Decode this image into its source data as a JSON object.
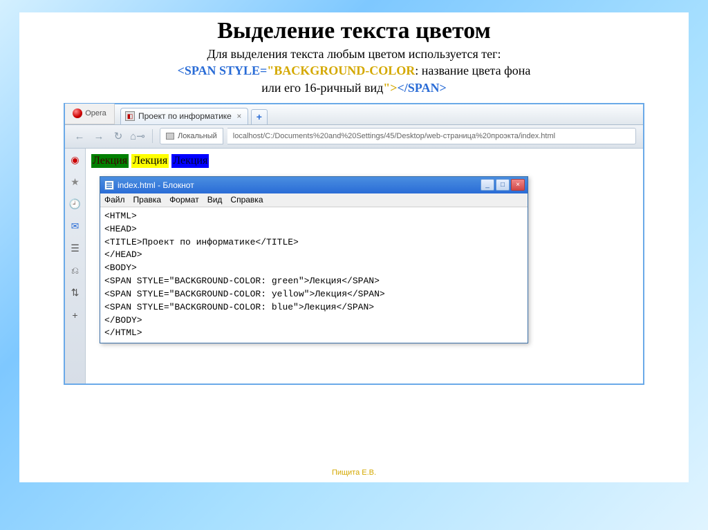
{
  "slide": {
    "title": "Выделение текста цветом",
    "desc_line1": "Для выделения текста любым цветом используется тег:",
    "tag_open": "<SPAN STYLE=",
    "quote_open": "\"",
    "css_prop": "BACKGROUND-COLOR",
    "colon_text": ": название цвета фона",
    "desc_line3": "или его 16-ричный вид",
    "quote_close": "\">",
    "tag_close": "</SPAN>",
    "footer": "Пищита Е.В."
  },
  "browser": {
    "menu_label": "Opera",
    "tab_title": "Проект по информатике",
    "address_label": "Локальный",
    "url": "localhost/C:/Documents%20and%20Settings/45/Desktop/web-страница%20проэкта/index.html"
  },
  "highlights": {
    "green": "Лекция",
    "yellow": "Лекция",
    "blue": "Лекция"
  },
  "notepad": {
    "title": "index.html - Блокнот",
    "menu": {
      "file": "Файл",
      "edit": "Правка",
      "format": "Формат",
      "view": "Вид",
      "help": "Справка"
    },
    "code_lines": [
      "<HTML>",
      "<HEAD>",
      "<TITLE>Проект по информатике</TITLE>",
      "</HEAD>",
      "<BODY>",
      "<SPAN STYLE=\"BACKGROUND-COLOR: green\">Лекция</SPAN>",
      "<SPAN STYLE=\"BACKGROUND-COLOR: yellow\">Лекция</SPAN>",
      "<SPAN STYLE=\"BACKGROUND-COLOR: blue\">Лекция</SPAN>",
      "</BODY>",
      "</HTML>"
    ]
  }
}
